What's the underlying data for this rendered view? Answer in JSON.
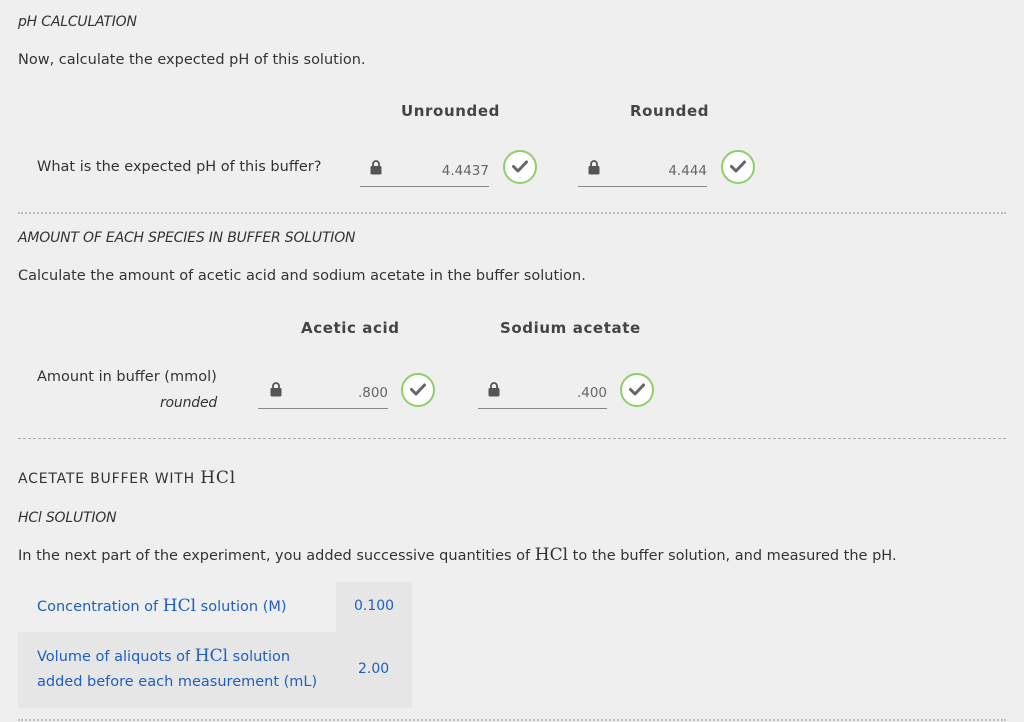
{
  "ph_section": {
    "title": "pH CALCULATION",
    "instruction": "Now, calculate the expected pH of this solution.",
    "col_unrounded": "Unrounded",
    "col_rounded": "Rounded",
    "question": "What is the expected pH of this buffer?",
    "unrounded_value": "4.4437",
    "rounded_value": "4.444"
  },
  "amount_section": {
    "title": "AMOUNT OF EACH SPECIES IN BUFFER SOLUTION",
    "instruction": "Calculate the amount of acetic acid and sodium acetate in the buffer solution.",
    "col_acetic": "Acetic acid",
    "col_sodium": "Sodium acetate",
    "row_label": "Amount in buffer (mmol)",
    "row_sublabel": "rounded",
    "acetic_value": ".800",
    "sodium_value": ".400"
  },
  "hcl_section": {
    "heading_prefix": "ACETATE BUFFER WITH",
    "heading_formula": "HCl",
    "subtitle": "HCl SOLUTION",
    "intro_before": "In the next part of the experiment, you added successive quantities of",
    "intro_formula": "HCl",
    "intro_after": "to the buffer solution, and measured the pH.",
    "conc_label_before": "Concentration of",
    "conc_label_formula": "HCl",
    "conc_label_after": "solution (M)",
    "conc_value": "0.100",
    "vol_label_line1_before": "Volume of aliquots of",
    "vol_label_formula": "HCl",
    "vol_label_line1_after": "solution",
    "vol_label_line2": "added before each measurement (mL)",
    "vol_value": "2.00"
  },
  "colors": {
    "check_green": "#8dcf6b",
    "link_blue": "#1f5fbf",
    "background": "#efefef"
  },
  "icons": [
    "lock-icon",
    "check-icon"
  ]
}
